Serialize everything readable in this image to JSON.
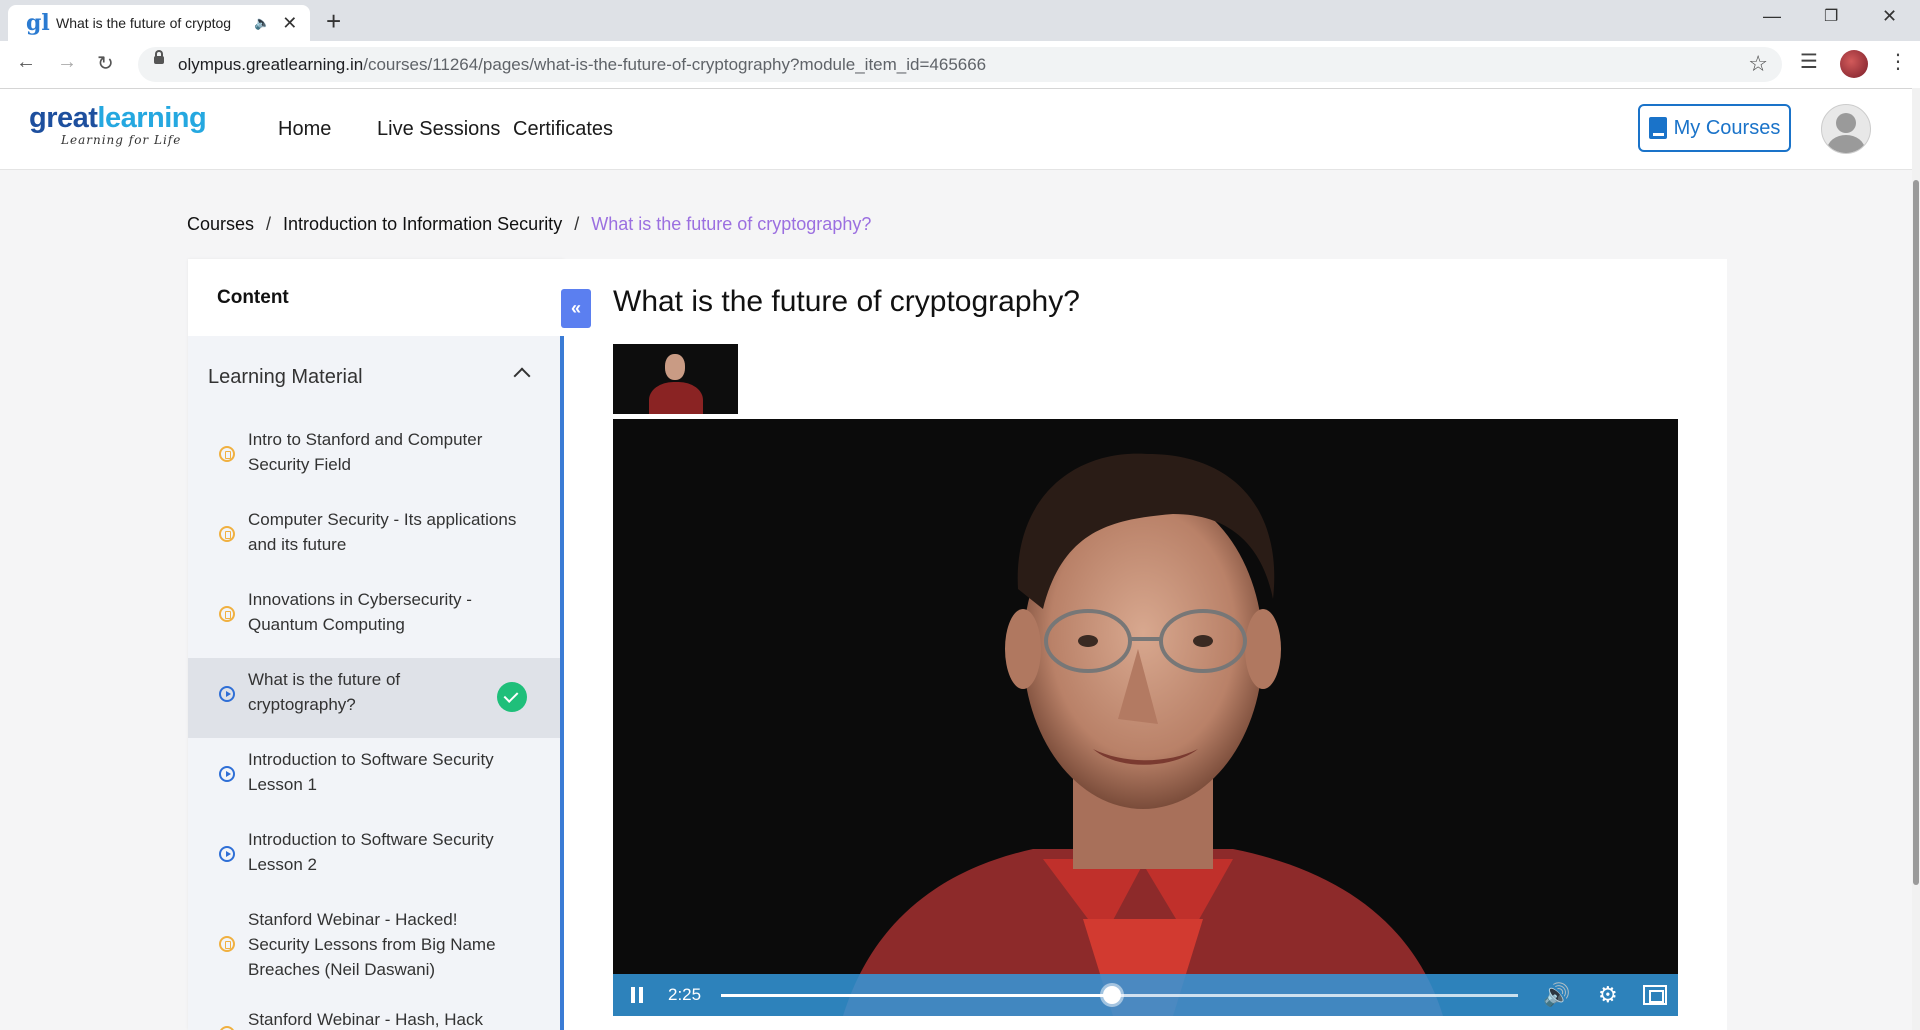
{
  "browser": {
    "tab_title": "What is the future of cryptog",
    "favicon": "gl",
    "url_host": "olympus.greatlearning.in",
    "url_path": "/courses/11264/pages/what-is-the-future-of-cryptography?module_item_id=465666"
  },
  "header": {
    "logo_main_1": "great",
    "logo_main_2": "learning",
    "logo_sub": "Learning for Life",
    "nav": [
      "Home",
      "Live Sessions",
      "Certificates"
    ],
    "my_courses": "My Courses"
  },
  "breadcrumb": {
    "items": [
      "Courses",
      "Introduction to Information Security"
    ],
    "current": "What is the future of cryptography?",
    "separator": "/"
  },
  "sidebar": {
    "title": "Content",
    "section": "Learning Material",
    "items": [
      {
        "label": "Intro to Stanford and Computer Security Field",
        "icon": "document-icon"
      },
      {
        "label": "Computer Security - Its applications and its future",
        "icon": "document-icon"
      },
      {
        "label": "Innovations in Cybersecurity - Quantum Computing",
        "icon": "document-icon"
      },
      {
        "label": "What is the future of cryptography?",
        "icon": "play-icon",
        "completed": true
      },
      {
        "label": "Introduction to Software Security Lesson 1",
        "icon": "play-icon"
      },
      {
        "label": "Introduction to Software Security Lesson 2",
        "icon": "play-icon"
      },
      {
        "label": "Stanford Webinar - Hacked! Security Lessons from Big Name Breaches (Neil Daswani)",
        "icon": "document-icon"
      },
      {
        "label": "Stanford Webinar - Hash, Hack",
        "icon": "document-icon"
      }
    ]
  },
  "main": {
    "title": "What is the future of cryptography?"
  },
  "video": {
    "time": "2:25",
    "progress": 0.49,
    "playing": true
  },
  "colors": {
    "accent": "#1a73c9",
    "breadcrumb_current": "#9b6fe0",
    "complete": "#1fbf7a",
    "controls_bar": "#3498db"
  }
}
